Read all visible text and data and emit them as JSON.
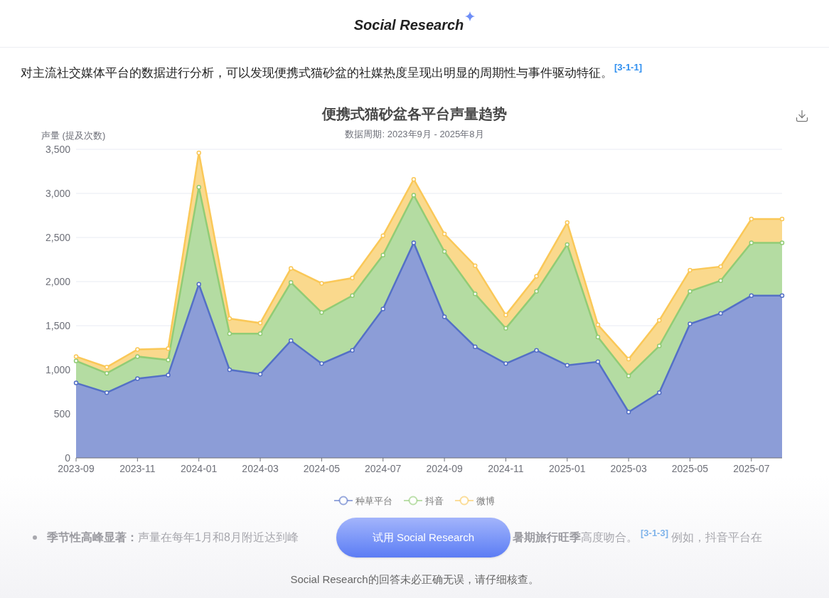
{
  "header": {
    "title": "Social Research"
  },
  "intro": {
    "text": "对主流社交媒体平台的数据进行分析，可以发现便携式猫砂盆的社媒热度呈现出明显的周期性与事件驱动特征。",
    "citation": "[3-1-1]"
  },
  "chart": {
    "subtitle": "数据周期: 2023年9月 - 2025年8月",
    "chart_data": {
      "type": "area",
      "title": "便携式猫砂盆各平台声量趋势",
      "ylabel": "声量 (提及次数)",
      "stacked": true,
      "grid": true,
      "categories": [
        "2023-09",
        null,
        "2023-11",
        null,
        "2024-01",
        null,
        "2024-03",
        null,
        "2024-05",
        null,
        "2024-07",
        null,
        "2024-09",
        null,
        "2024-11",
        null,
        "2025-01",
        null,
        "2025-03",
        null,
        "2025-05",
        null,
        "2025-07",
        null
      ],
      "series": [
        {
          "name": "种草平台",
          "color": "#5470c6",
          "values": [
            850,
            740,
            900,
            940,
            1970,
            1000,
            950,
            1330,
            1070,
            1220,
            1690,
            2440,
            1600,
            1260,
            1070,
            1220,
            1050,
            1090,
            520,
            740,
            1520,
            1640,
            1840,
            1840
          ]
        },
        {
          "name": "抖音",
          "color": "#91cc75",
          "values": [
            250,
            220,
            250,
            170,
            1100,
            410,
            460,
            660,
            580,
            620,
            610,
            540,
            740,
            600,
            400,
            670,
            1370,
            280,
            410,
            530,
            370,
            370,
            600,
            600
          ]
        },
        {
          "name": "微博",
          "color": "#fac858",
          "values": [
            50,
            70,
            80,
            130,
            390,
            170,
            120,
            160,
            330,
            200,
            220,
            180,
            200,
            320,
            150,
            170,
            250,
            140,
            190,
            290,
            240,
            160,
            270,
            270
          ]
        }
      ],
      "ylim": [
        0,
        3500
      ],
      "yticks": [
        {
          "value": 0,
          "label": "0"
        },
        {
          "value": 500,
          "label": "500"
        },
        {
          "value": 1000,
          "label": "1,000"
        },
        {
          "value": 1500,
          "label": "1,500"
        },
        {
          "value": 2000,
          "label": "2,000"
        },
        {
          "value": 2500,
          "label": "2,500"
        },
        {
          "value": 3000,
          "label": "3,000"
        },
        {
          "value": 3500,
          "label": "3,500"
        }
      ]
    }
  },
  "bullet": {
    "text_before": "**季节性高峰显著：**声量在每年1月和8月附近达到峰",
    "text_after": "**暑期旅行旺季**高度吻合。",
    "citation": "[3-1-3]",
    "text_end": "例如，抖音平台在"
  },
  "cta_button": "试用 Social Research",
  "disclaimer": "Social Research的回答未必正确无误，请仔细核查。"
}
